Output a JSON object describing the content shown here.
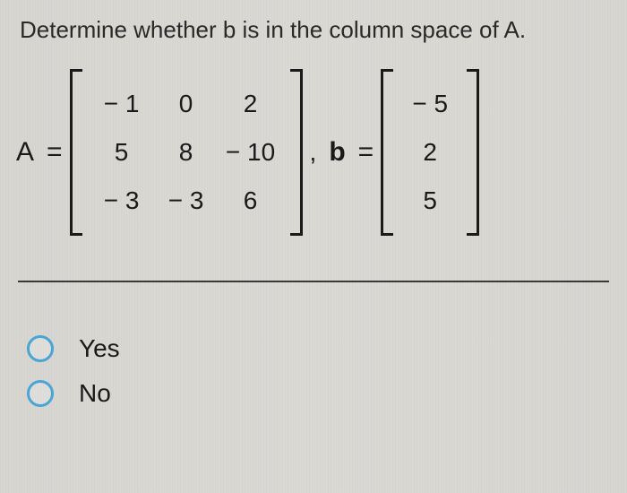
{
  "question": "Determine whether b is in the column space of A.",
  "labels": {
    "A": "A",
    "b": "b",
    "eq": "=",
    "comma": ","
  },
  "matrixA": {
    "rows": [
      [
        "− 1",
        "0",
        "2"
      ],
      [
        "5",
        "8",
        "− 10"
      ],
      [
        "− 3",
        "− 3",
        "6"
      ]
    ]
  },
  "vectorB": {
    "rows": [
      [
        "− 5"
      ],
      [
        "2"
      ],
      [
        "5"
      ]
    ]
  },
  "options": [
    {
      "label": "Yes",
      "selected": false
    },
    {
      "label": "No",
      "selected": false
    }
  ],
  "chart_data": {
    "type": "table",
    "title": "Linear algebra column-space membership problem",
    "A": [
      [
        -1,
        0,
        2
      ],
      [
        5,
        8,
        -10
      ],
      [
        -3,
        -3,
        6
      ]
    ],
    "b": [
      -5,
      2,
      5
    ]
  }
}
